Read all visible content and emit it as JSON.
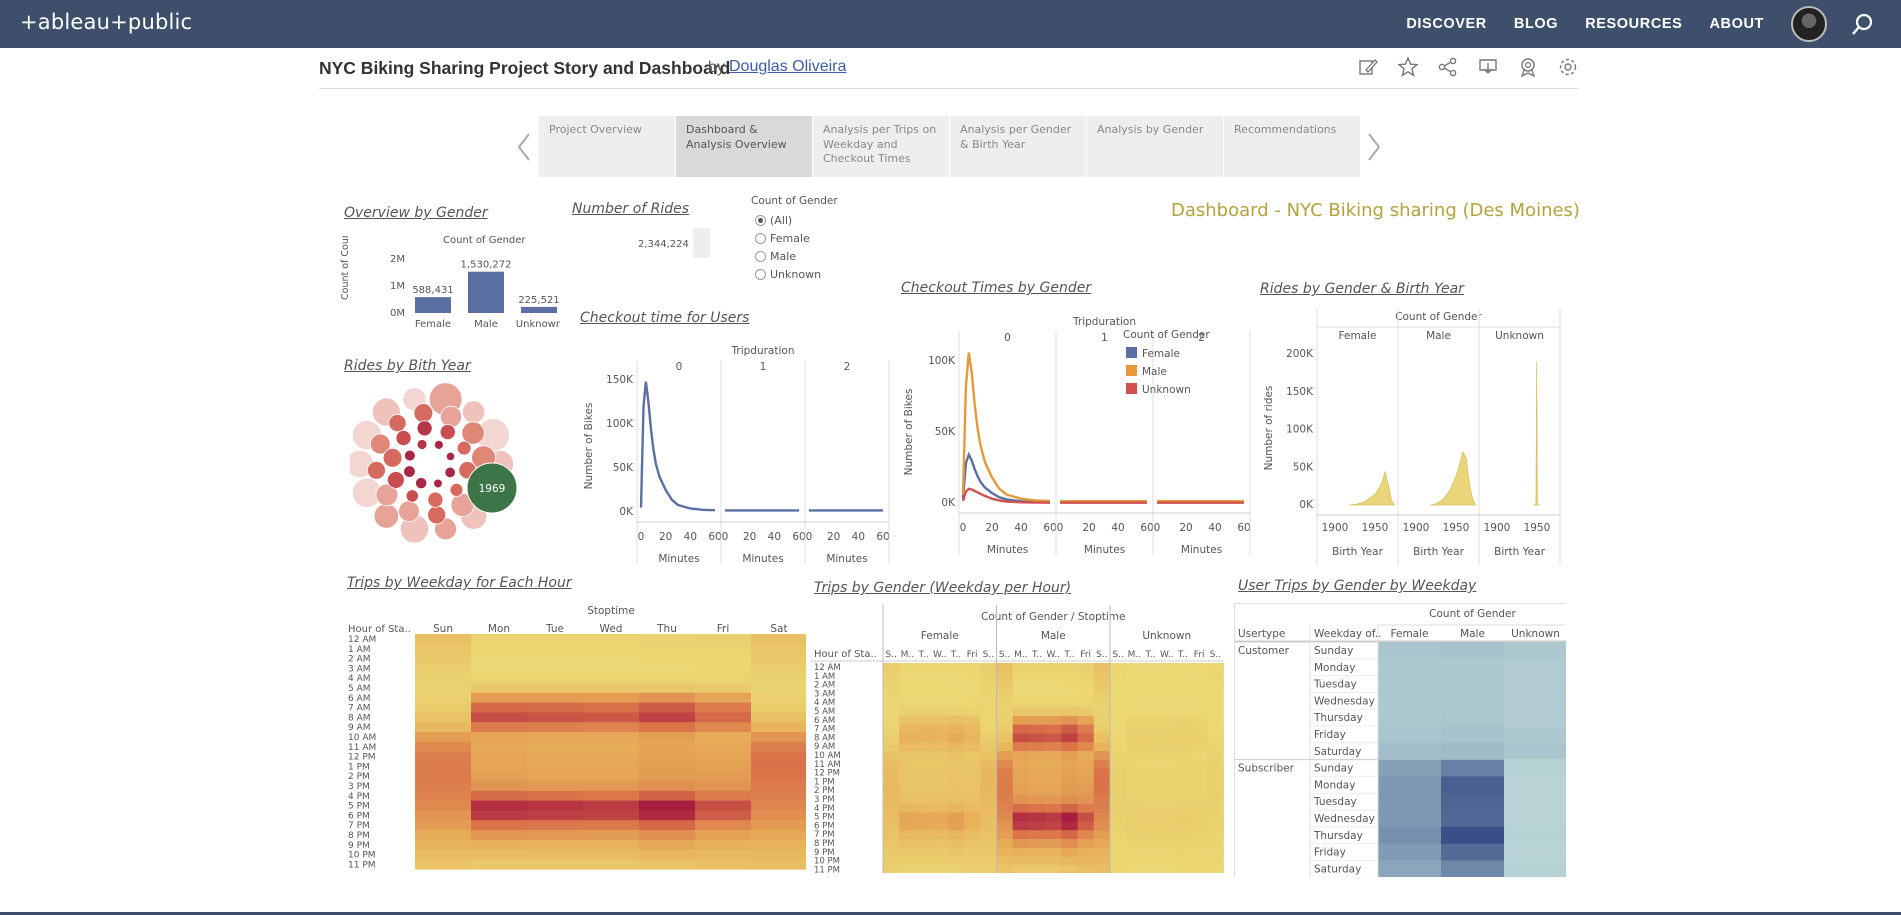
{
  "topbar": {
    "logo": "+ableau+public",
    "nav": [
      "DISCOVER",
      "BLOG",
      "RESOURCES",
      "ABOUT"
    ]
  },
  "viz": {
    "title": "NYC Biking Sharing Project Story and Dashboard",
    "by": "by",
    "author": "Douglas Oliveira",
    "tools": [
      "edit-icon",
      "star-icon",
      "share-icon",
      "download-icon",
      "badge-icon",
      "settings-icon"
    ]
  },
  "story": {
    "tabs": [
      "Project Overview",
      "Dashboard & Analysis Overview",
      "Analysis per Trips on Weekday and Checkout Times",
      "Analysis per Gender & Birth Year",
      "Analysis by Gender",
      "Recommendations"
    ],
    "active_tab": 1
  },
  "dashboard": {
    "title": "Dashboard - NYC Biking sharing (Des Moines)",
    "overview_gender": {
      "title": "Overview by Gender",
      "header": "Count of Gender",
      "yaxis": "Count of Count of..."
    },
    "number_of_rides": {
      "title": "Number of Rides",
      "value": "2,344,224"
    },
    "filter": {
      "title": "Count of Gender",
      "options": [
        "(All)",
        "Female",
        "Male",
        "Unknown"
      ],
      "selected": "(All)"
    },
    "birth_year": {
      "title": "Rides by Bith Year",
      "highlight": "1969"
    },
    "checkout_users": {
      "title": "Checkout time for Users",
      "header": "Tripduration",
      "panels": [
        "0",
        "1",
        "2"
      ],
      "ylabel": "Number of Bikes",
      "xlabel": "Minutes",
      "yticks": [
        "150K",
        "100K",
        "50K",
        "0K"
      ],
      "xticks": [
        "0",
        "20",
        "40",
        "60"
      ]
    },
    "checkout_gender": {
      "title": "Checkout Times by Gender",
      "header": "Tripduration",
      "panels": [
        "0",
        "1",
        "2"
      ],
      "ylabel": "Number of Bikes",
      "xlabel": "Minutes",
      "yticks": [
        "100K",
        "50K",
        "0K"
      ],
      "xticks": [
        "0",
        "20",
        "40",
        "60"
      ],
      "legend_title": "Count of Gender",
      "legend": [
        "Female",
        "Male",
        "Unknown"
      ]
    },
    "rides_gender_birth": {
      "title": "Rides by Gender & Birth Year",
      "header": "Count of Gender",
      "panels": [
        "Female",
        "Male",
        "Unknown"
      ],
      "ylabel": "Number of rides",
      "xlabel": "Birth Year",
      "yticks": [
        "200K",
        "150K",
        "100K",
        "50K",
        "0K"
      ],
      "xticks": [
        "1900",
        "1950"
      ]
    },
    "trips_weekday": {
      "title": "Trips by Weekday for Each Hour",
      "header": "Stoptime",
      "row_header": "Hour of Sta..",
      "days": [
        "Sun",
        "Mon",
        "Tue",
        "Wed",
        "Thu",
        "Fri",
        "Sat"
      ]
    },
    "trips_gender": {
      "title": "Trips by Gender (Weekday per Hour)",
      "header": "Count of Gender / Stoptime",
      "row_header": "Hour of Sta..",
      "groups": [
        "Female",
        "Male",
        "Unknown"
      ],
      "subheads": [
        "S..",
        "M..",
        "T..",
        "W..",
        "T..",
        "Fri",
        "S.."
      ]
    },
    "user_trips": {
      "title": "User Trips by Gender by Weekday",
      "header": "Count of Gender",
      "col_usertype": "Usertype",
      "col_weekday": "Weekday of..",
      "cols": [
        "Female",
        "Male",
        "Unknown"
      ],
      "usertypes": [
        "Customer",
        "Subscriber"
      ],
      "days": [
        "Sunday",
        "Monday",
        "Tuesday",
        "Wednesday",
        "Thursday",
        "Friday",
        "Saturday"
      ]
    },
    "hours": [
      "12 AM",
      "1 AM",
      "2 AM",
      "3 AM",
      "4 AM",
      "5 AM",
      "6 AM",
      "7 AM",
      "8 AM",
      "9 AM",
      "10 AM",
      "11 AM",
      "12 PM",
      "1 PM",
      "2 PM",
      "3 PM",
      "4 PM",
      "5 PM",
      "6 PM",
      "7 PM",
      "8 PM",
      "9 PM",
      "10 PM",
      "11 PM"
    ]
  },
  "chart_data": [
    {
      "type": "bar",
      "title": "Count of Gender",
      "categories": [
        "Female",
        "Male",
        "Unknown"
      ],
      "values": [
        588431,
        1530272,
        225521
      ],
      "labels": [
        "588,431",
        "1,530,272",
        "225,521"
      ],
      "yticks": [
        "2M",
        "1M",
        "0M"
      ],
      "ylim": [
        0,
        2000000
      ],
      "color": "#5b6fa3"
    },
    {
      "type": "line",
      "title": "Checkout time for Users",
      "x": [
        0,
        2,
        4,
        6,
        8,
        10,
        12,
        15,
        20,
        25,
        30,
        40,
        50,
        60
      ],
      "y": [
        5000,
        120000,
        148000,
        125000,
        95000,
        72000,
        55000,
        40000,
        25000,
        14000,
        8000,
        4000,
        2500,
        2000
      ],
      "ylim": [
        0,
        160000
      ],
      "xlim": [
        0,
        60
      ],
      "color": "#5b6fa3"
    },
    {
      "type": "line",
      "title": "Checkout Times by Gender",
      "x": [
        0,
        2,
        4,
        6,
        8,
        10,
        12,
        15,
        20,
        25,
        30,
        40,
        50,
        60
      ],
      "series": [
        {
          "name": "Female",
          "color": "#5b6fa3",
          "values": [
            3000,
            28000,
            34000,
            30000,
            24000,
            19000,
            15000,
            11000,
            7000,
            4000,
            2500,
            1200,
            800,
            600
          ]
        },
        {
          "name": "Male",
          "color": "#e59a3a",
          "values": [
            6000,
            82000,
            106000,
            92000,
            70000,
            53000,
            41000,
            29000,
            18000,
            10000,
            6000,
            3000,
            1800,
            1400
          ]
        },
        {
          "name": "Unknown",
          "color": "#d0514f",
          "values": [
            1500,
            8000,
            10000,
            9500,
            8500,
            7500,
            6500,
            5000,
            3000,
            1800,
            1000,
            500,
            300,
            200
          ]
        }
      ],
      "ylim": [
        0,
        110000
      ],
      "xlim": [
        0,
        60
      ]
    },
    {
      "type": "area",
      "title": "Rides by Gender & Birth Year",
      "color": "#ead57a",
      "series": [
        {
          "name": "Female",
          "x": [
            1930,
            1940,
            1950,
            1960,
            1970,
            1980,
            1985,
            1990,
            1995,
            2000
          ],
          "values": [
            0,
            1000,
            3000,
            8000,
            15000,
            30000,
            45000,
            28000,
            6000,
            0
          ]
        },
        {
          "name": "Male",
          "x": [
            1930,
            1940,
            1950,
            1960,
            1970,
            1975,
            1980,
            1985,
            1990,
            1995,
            2000
          ],
          "values": [
            0,
            2000,
            8000,
            20000,
            40000,
            55000,
            72000,
            65000,
            30000,
            8000,
            0
          ]
        },
        {
          "name": "Unknown",
          "x": [
            1965,
            1968,
            1969,
            1970,
            1973
          ],
          "values": [
            0,
            2000,
            195000,
            2000,
            0
          ]
        }
      ],
      "ylim": [
        0,
        210000
      ],
      "xlim": [
        1880,
        2005
      ]
    },
    {
      "type": "heatmap",
      "title": "Trips by Weekday for Each Hour",
      "x": [
        "Sun",
        "Mon",
        "Tue",
        "Wed",
        "Thu",
        "Fri",
        "Sat"
      ],
      "y": [
        "12 AM",
        "1 AM",
        "2 AM",
        "3 AM",
        "4 AM",
        "5 AM",
        "6 AM",
        "7 AM",
        "8 AM",
        "9 AM",
        "10 AM",
        "11 AM",
        "12 PM",
        "1 PM",
        "2 PM",
        "3 PM",
        "4 PM",
        "5 PM",
        "6 PM",
        "7 PM",
        "8 PM",
        "9 PM",
        "10 PM",
        "11 PM"
      ],
      "values": [
        [
          0.22,
          0.05,
          0.05,
          0.05,
          0.06,
          0.08,
          0.22
        ],
        [
          0.18,
          0.03,
          0.03,
          0.03,
          0.04,
          0.05,
          0.18
        ],
        [
          0.14,
          0.02,
          0.02,
          0.02,
          0.03,
          0.03,
          0.14
        ],
        [
          0.1,
          0.02,
          0.02,
          0.02,
          0.02,
          0.03,
          0.11
        ],
        [
          0.07,
          0.04,
          0.04,
          0.04,
          0.04,
          0.05,
          0.07
        ],
        [
          0.06,
          0.15,
          0.15,
          0.15,
          0.16,
          0.14,
          0.06
        ],
        [
          0.08,
          0.45,
          0.45,
          0.45,
          0.5,
          0.42,
          0.08
        ],
        [
          0.12,
          0.7,
          0.68,
          0.66,
          0.75,
          0.62,
          0.12
        ],
        [
          0.2,
          0.8,
          0.78,
          0.76,
          0.85,
          0.7,
          0.22
        ],
        [
          0.3,
          0.62,
          0.6,
          0.58,
          0.65,
          0.55,
          0.34
        ],
        [
          0.45,
          0.42,
          0.4,
          0.4,
          0.45,
          0.38,
          0.5
        ],
        [
          0.55,
          0.4,
          0.38,
          0.38,
          0.42,
          0.4,
          0.6
        ],
        [
          0.6,
          0.42,
          0.4,
          0.4,
          0.44,
          0.42,
          0.65
        ],
        [
          0.62,
          0.42,
          0.4,
          0.4,
          0.45,
          0.44,
          0.66
        ],
        [
          0.62,
          0.44,
          0.42,
          0.42,
          0.46,
          0.46,
          0.65
        ],
        [
          0.6,
          0.5,
          0.48,
          0.48,
          0.52,
          0.5,
          0.62
        ],
        [
          0.58,
          0.68,
          0.66,
          0.64,
          0.72,
          0.62,
          0.6
        ],
        [
          0.55,
          0.92,
          0.9,
          0.88,
          1.0,
          0.8,
          0.56
        ],
        [
          0.5,
          0.88,
          0.86,
          0.84,
          0.95,
          0.74,
          0.52
        ],
        [
          0.45,
          0.65,
          0.64,
          0.63,
          0.7,
          0.56,
          0.46
        ],
        [
          0.38,
          0.48,
          0.47,
          0.46,
          0.52,
          0.44,
          0.4
        ],
        [
          0.32,
          0.36,
          0.35,
          0.35,
          0.4,
          0.36,
          0.35
        ],
        [
          0.26,
          0.26,
          0.26,
          0.26,
          0.3,
          0.3,
          0.3
        ],
        [
          0.2,
          0.15,
          0.15,
          0.15,
          0.18,
          0.22,
          0.24
        ]
      ]
    },
    {
      "type": "heatmap",
      "title": "Trips by Gender (Weekday per Hour)",
      "groups": [
        "Female",
        "Male",
        "Unknown"
      ],
      "x": [
        "Sun",
        "Mon",
        "Tue",
        "Wed",
        "Thu",
        "Fri",
        "Sat"
      ],
      "y": [
        "12 AM",
        "1 AM",
        "2 AM",
        "3 AM",
        "4 AM",
        "5 AM",
        "6 AM",
        "7 AM",
        "8 AM",
        "9 AM",
        "10 AM",
        "11 AM",
        "12 PM",
        "1 PM",
        "2 PM",
        "3 PM",
        "4 PM",
        "5 PM",
        "6 PM",
        "7 PM",
        "8 PM",
        "9 PM",
        "10 PM",
        "11 PM"
      ],
      "group_scale": [
        0.45,
        1.0,
        0.12
      ]
    },
    {
      "type": "heatmap",
      "title": "User Trips by Gender by Weekday",
      "x": [
        "Female",
        "Male",
        "Unknown"
      ],
      "rows": [
        "Customer",
        "Subscriber"
      ],
      "y": [
        "Sunday",
        "Monday",
        "Tuesday",
        "Wednesday",
        "Thursday",
        "Friday",
        "Saturday"
      ],
      "values": [
        [
          [
            0.22,
            0.24,
            0.2
          ],
          [
            0.2,
            0.2,
            0.18
          ],
          [
            0.2,
            0.2,
            0.18
          ],
          [
            0.2,
            0.2,
            0.18
          ],
          [
            0.2,
            0.21,
            0.18
          ],
          [
            0.22,
            0.23,
            0.2
          ],
          [
            0.26,
            0.28,
            0.22
          ]
        ],
        [
          [
            0.45,
            0.65,
            0.14
          ],
          [
            0.5,
            0.85,
            0.13
          ],
          [
            0.5,
            0.82,
            0.13
          ],
          [
            0.5,
            0.8,
            0.13
          ],
          [
            0.55,
            0.95,
            0.14
          ],
          [
            0.48,
            0.78,
            0.13
          ],
          [
            0.42,
            0.6,
            0.14
          ]
        ]
      ]
    }
  ]
}
